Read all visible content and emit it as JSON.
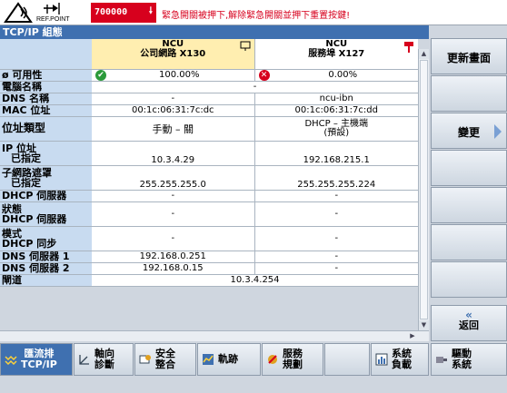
{
  "header": {
    "refpoint_label": "REF.POINT",
    "alarm_number": "700000",
    "alarm_text": "緊急開關被押下,解除緊急開關並押下重置按鍵!"
  },
  "panel": {
    "title": "TCP/IP 組態"
  },
  "columns": [
    {
      "line1": "NCU",
      "line2": "公司網路 X130"
    },
    {
      "line1": "NCU",
      "line2": "服務埠 X127"
    }
  ],
  "rows": {
    "availability": {
      "label": "ø 可用性",
      "c1": "100.00%",
      "c2": "0.00%"
    },
    "computer_name": {
      "label": "電腦名稱",
      "span": "-"
    },
    "dns_name": {
      "label": "DNS 名稱",
      "c1": "-",
      "c2": "ncu-ibn"
    },
    "mac": {
      "label": "MAC 位址",
      "c1": "00:1c:06:31:7c:dc",
      "c2": "00:1c:06:31:7c:dd"
    },
    "addr_type": {
      "label": "位址類型",
      "c1": "手動 – 關",
      "c2a": "DHCP – 主機端",
      "c2b": "(預設)"
    },
    "ip": {
      "label1": "IP 位址",
      "label2": "已指定",
      "c1": "10.3.4.29",
      "c2": "192.168.215.1"
    },
    "subnet": {
      "label1": "子網路遮罩",
      "label2": "已指定",
      "c1": "255.255.255.0",
      "c2": "255.255.255.224"
    },
    "dhcp_server": {
      "label": "DHCP 伺服器",
      "c1": "-",
      "c2": "-"
    },
    "state": {
      "label1": "狀態",
      "label2": "DHCP 伺服器",
      "c1": "-",
      "c2": "-"
    },
    "mode": {
      "label1": "模式",
      "label2": "DHCP 同步",
      "c1": "-",
      "c2": "-"
    },
    "dns1": {
      "label": "DNS 伺服器 1",
      "c1": "192.168.0.251",
      "c2": "-"
    },
    "dns2": {
      "label": "DNS 伺服器 2",
      "c1": "192.168.0.15",
      "c2": "-"
    },
    "gateway": {
      "label": "閘道",
      "span": "10.3.4.254"
    }
  },
  "vsoftkeys": {
    "refresh": "更新畫面",
    "change": "變更",
    "back_chevron": "«",
    "back": "返回"
  },
  "hsoftkeys": {
    "network_diag_l1": "匯流排",
    "network_diag_l2": "TCP/IP",
    "axis_diag_l1": "軸向",
    "axis_diag_l2": "診斷",
    "safety_l1": "安全",
    "safety_l2": "整合",
    "trace": "軌跡",
    "service_l1": "服務",
    "service_l2": "規劃",
    "sys_load_l1": "系統",
    "sys_load_l2": "負載",
    "drive_l1": "驅動",
    "drive_l2": "系統"
  },
  "colors": {
    "alarm": "#d7001d",
    "accent": "#3f70b0",
    "label_bg": "#c8dbf0",
    "header_highlight": "#ffeeb0"
  }
}
